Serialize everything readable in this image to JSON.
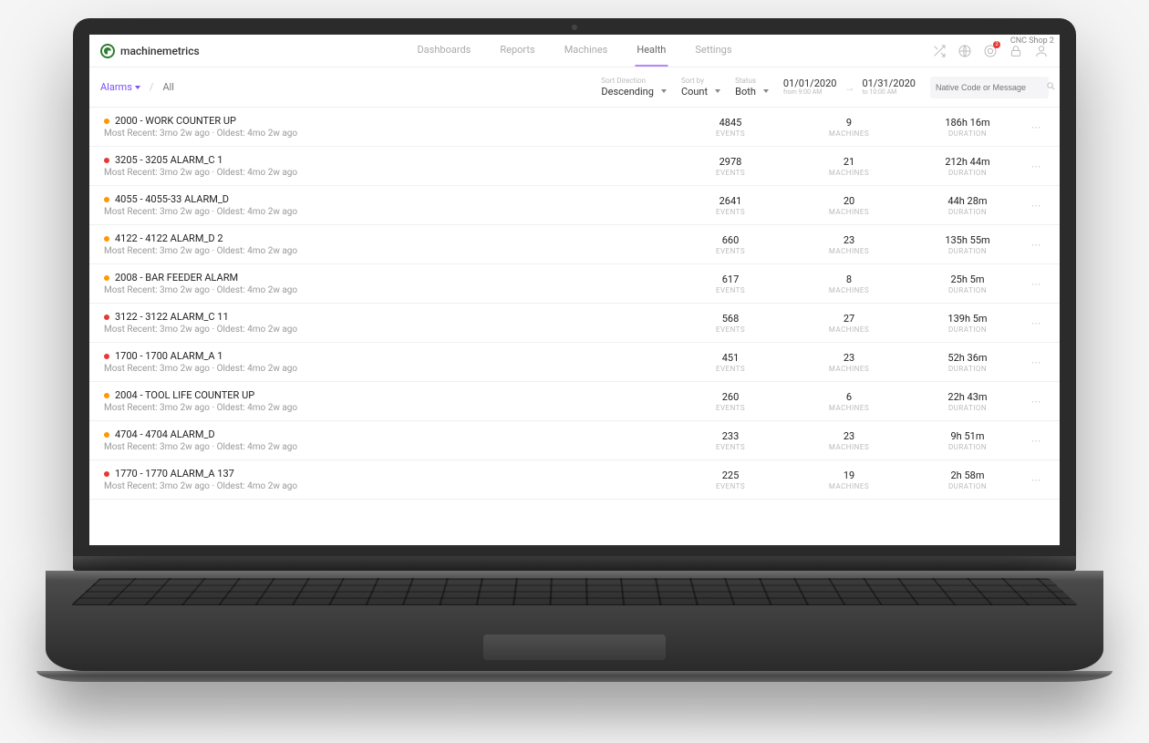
{
  "cornerText": "CNC Shop 2",
  "brand": "machinemetrics",
  "nav": {
    "items": [
      "Dashboards",
      "Reports",
      "Machines",
      "Health",
      "Settings"
    ],
    "activeIndex": 3,
    "notificationBadge": "2"
  },
  "breadcrumb": {
    "alarms": "Alarms",
    "all": "All"
  },
  "filters": {
    "sortDirection": {
      "label": "Sort Direction",
      "value": "Descending"
    },
    "sortBy": {
      "label": "Sort by",
      "value": "Count"
    },
    "status": {
      "label": "Status",
      "value": "Both"
    },
    "dateFrom": {
      "value": "01/01/2020",
      "sub": "from 9:00 AM"
    },
    "dateTo": {
      "value": "01/31/2020",
      "sub": "to 10:00 AM"
    }
  },
  "search": {
    "placeholder": "Native Code or Message"
  },
  "colLabels": {
    "events": "EVENTS",
    "machines": "MACHINES",
    "duration": "DURATION"
  },
  "subLine": "Most Recent: 3mo 2w ago · Oldest: 4mo 2w ago",
  "rows": [
    {
      "color": "orange",
      "title": "2000 - WORK COUNTER UP",
      "events": "4845",
      "machines": "9",
      "duration": "186h 16m"
    },
    {
      "color": "red",
      "title": "3205 - 3205 ALARM_C 1",
      "events": "2978",
      "machines": "21",
      "duration": "212h 44m"
    },
    {
      "color": "orange",
      "title": "4055 - 4055-33 ALARM_D",
      "events": "2641",
      "machines": "20",
      "duration": "44h 28m"
    },
    {
      "color": "orange",
      "title": "4122 - 4122 ALARM_D 2",
      "events": "660",
      "machines": "23",
      "duration": "135h 55m"
    },
    {
      "color": "orange",
      "title": "2008 - BAR FEEDER ALARM",
      "events": "617",
      "machines": "8",
      "duration": "25h 5m"
    },
    {
      "color": "red",
      "title": "3122 - 3122 ALARM_C 11",
      "events": "568",
      "machines": "27",
      "duration": "139h 5m"
    },
    {
      "color": "red",
      "title": "1700 - 1700 ALARM_A 1",
      "events": "451",
      "machines": "23",
      "duration": "52h 36m"
    },
    {
      "color": "orange",
      "title": "2004 - TOOL LIFE COUNTER UP",
      "events": "260",
      "machines": "6",
      "duration": "22h 43m"
    },
    {
      "color": "orange",
      "title": "4704 - 4704 ALARM_D",
      "events": "233",
      "machines": "23",
      "duration": "9h 51m"
    },
    {
      "color": "red",
      "title": "1770 - 1770 ALARM_A 137",
      "events": "225",
      "machines": "19",
      "duration": "2h 58m"
    }
  ]
}
